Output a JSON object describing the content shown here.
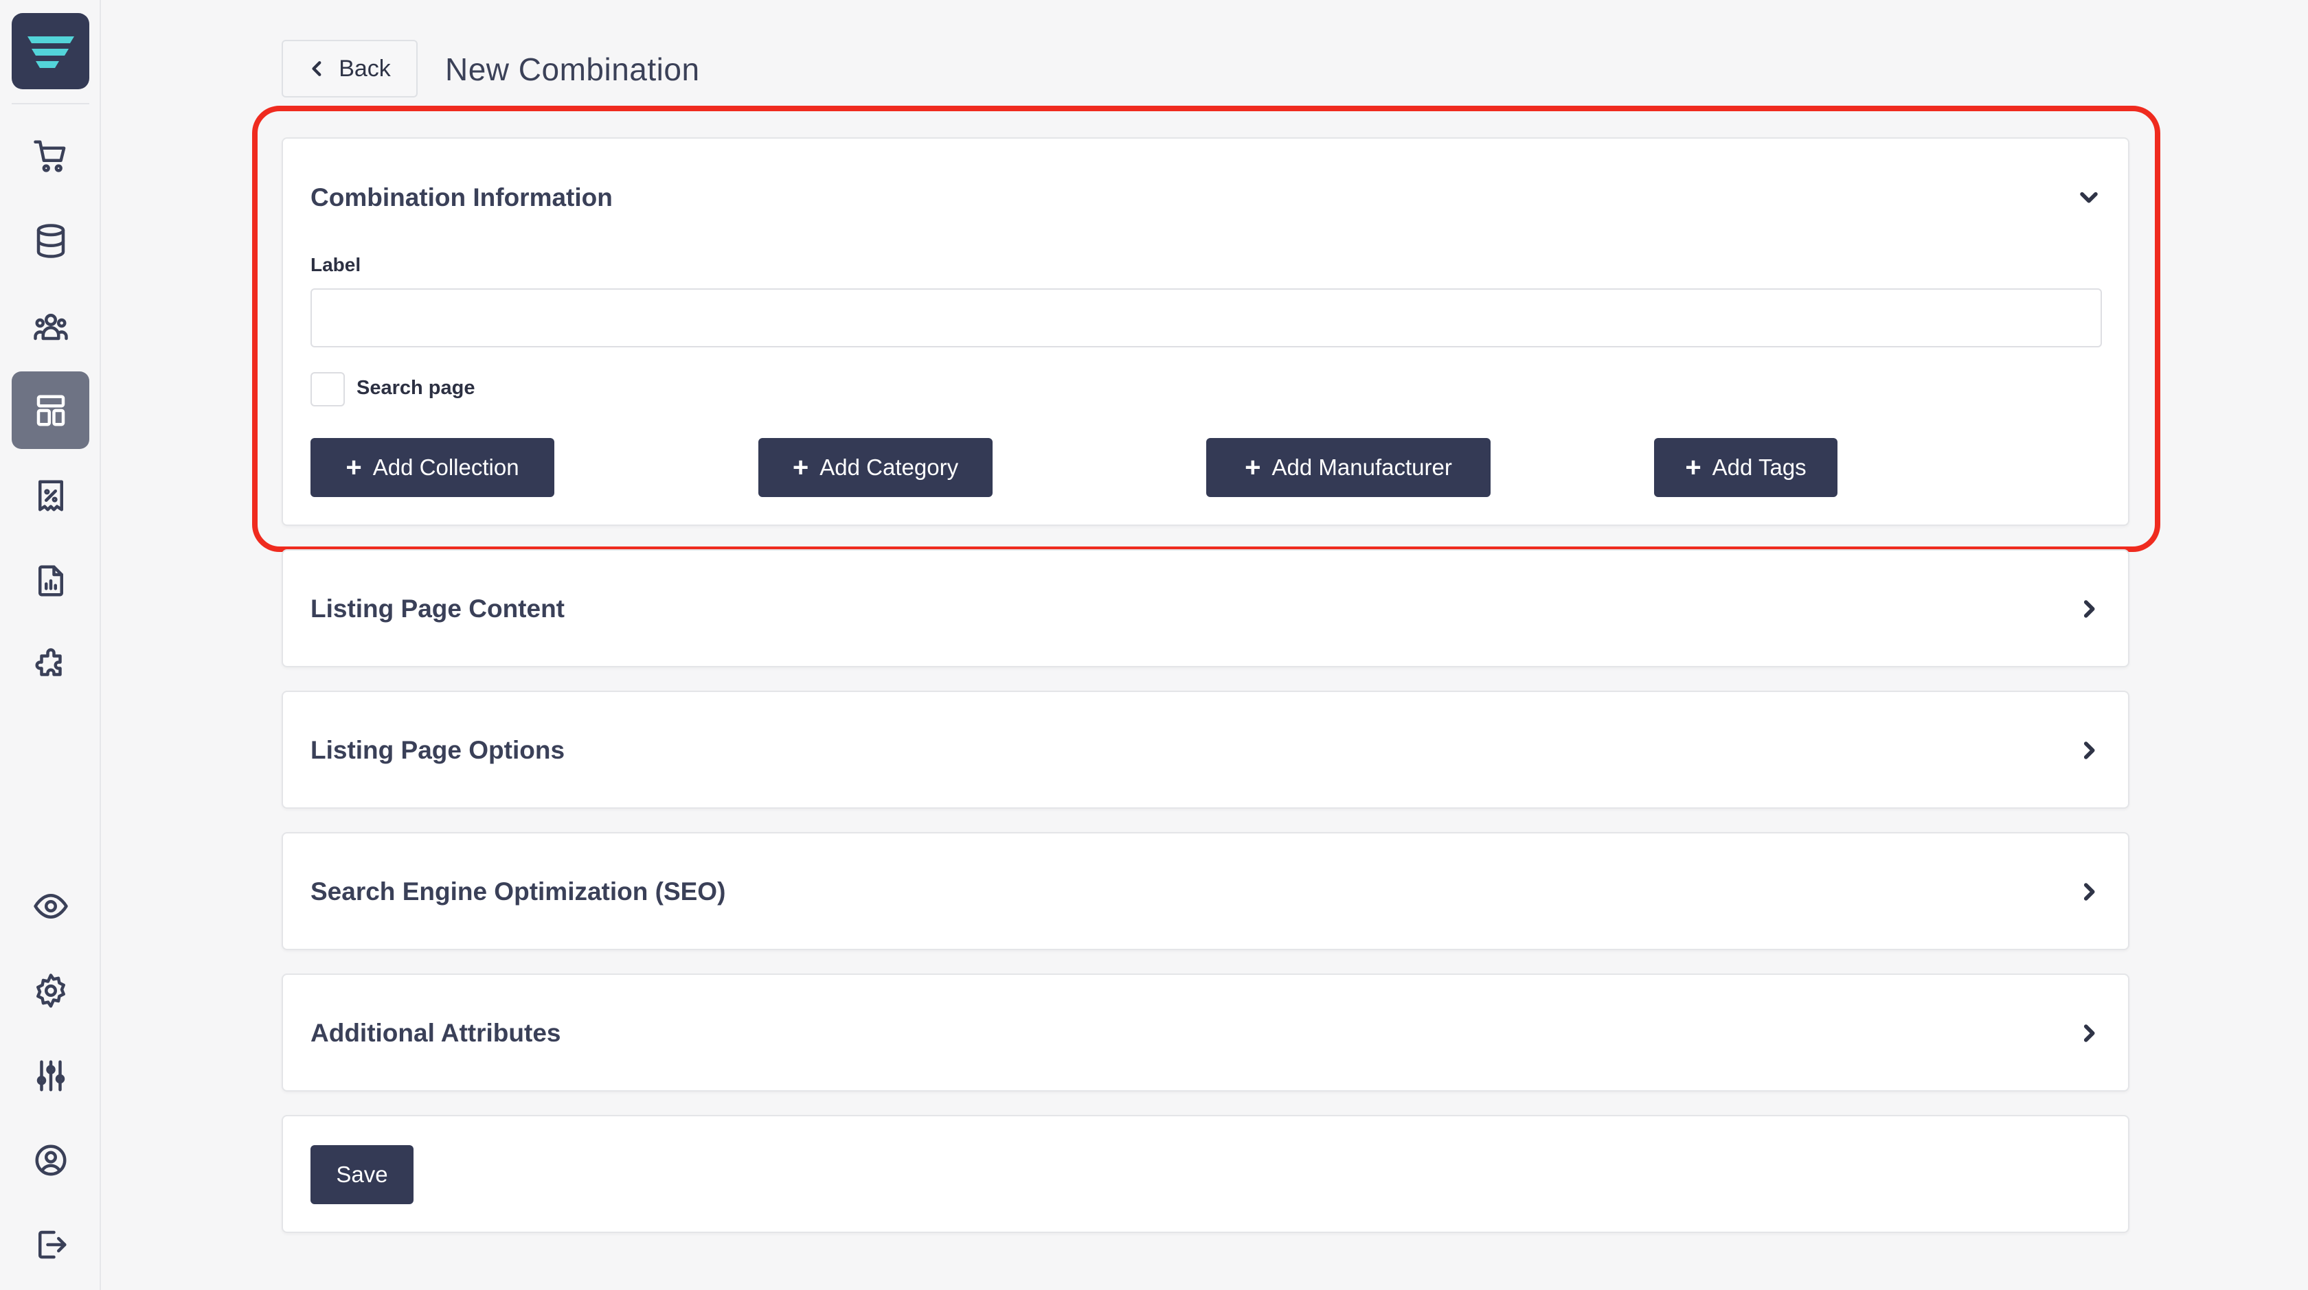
{
  "header": {
    "back_label": "Back",
    "page_title": "New Combination"
  },
  "sidebar": {
    "items": [
      {
        "icon": "cart-icon",
        "active": false
      },
      {
        "icon": "database-icon",
        "active": false
      },
      {
        "icon": "users-icon",
        "active": false
      },
      {
        "icon": "layout-icon",
        "active": true
      },
      {
        "icon": "discount-receipt-icon",
        "active": false
      },
      {
        "icon": "report-icon",
        "active": false
      },
      {
        "icon": "puzzle-icon",
        "active": false
      },
      {
        "icon": "eye-icon",
        "active": false
      },
      {
        "icon": "gear-icon",
        "active": false
      },
      {
        "icon": "sliders-icon",
        "active": false
      },
      {
        "icon": "user-circle-icon",
        "active": false
      },
      {
        "icon": "logout-icon",
        "active": false
      }
    ]
  },
  "combination_info": {
    "title": "Combination Information",
    "label_field": {
      "label": "Label",
      "value": "",
      "placeholder": ""
    },
    "search_page": {
      "label": "Search page",
      "checked": false
    },
    "buttons": {
      "add_collection": "Add Collection",
      "add_category": "Add Category",
      "add_manufacturer": "Add Manufacturer",
      "add_tags": "Add Tags"
    }
  },
  "sections": [
    {
      "title": "Listing Page Content"
    },
    {
      "title": "Listing Page Options"
    },
    {
      "title": "Search Engine Optimization (SEO)"
    },
    {
      "title": "Additional Attributes"
    }
  ],
  "footer": {
    "save_label": "Save"
  },
  "colors": {
    "primary": "#343a55",
    "highlight": "#ef2b1f",
    "background": "#f6f6f7"
  }
}
